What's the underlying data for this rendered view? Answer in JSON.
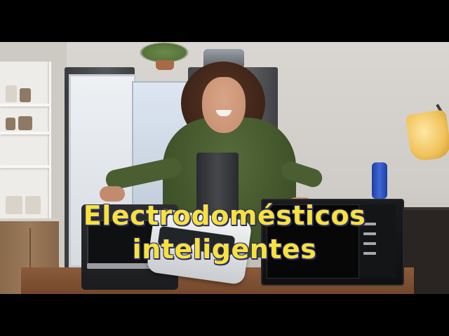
{
  "video_frame": {
    "title_line1": "Electrodomésticos",
    "title_line2": "inteligentes",
    "title_color": "#f7e23a",
    "title_outline_color": "#2b2b6b"
  }
}
